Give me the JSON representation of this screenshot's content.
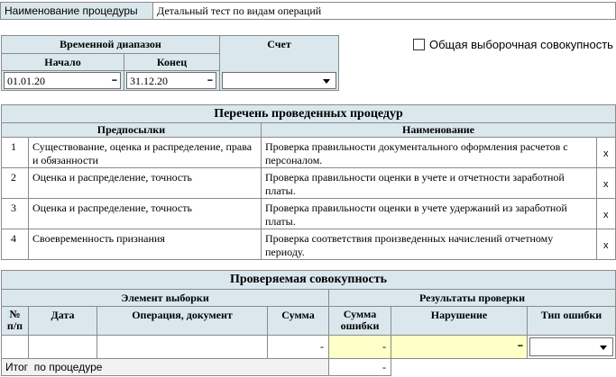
{
  "procedure": {
    "label": "Наименование процедуры",
    "value": "Детальный тест по видам операций"
  },
  "time_range": {
    "header": "Временной диапазон",
    "start_label": "Начало",
    "end_label": "Конец",
    "start_value": "01.01.20",
    "end_value": "31.12.20"
  },
  "account": {
    "header": "Счет",
    "value": ""
  },
  "total_population": {
    "label": "Общая выборочная совокупность",
    "checked": false
  },
  "procedures_list": {
    "title": "Перечень проведенных процедур",
    "col_premises": "Предпосылки",
    "col_name": "Наименование",
    "rows": [
      {
        "num": "1",
        "premise": "Существование, оценка и распределение, права и обязанности",
        "name": "Проверка правильности документального оформления расчетов с персоналом.",
        "dots": "...",
        "x": "x"
      },
      {
        "num": "2",
        "premise": "Оценка и распределение, точность",
        "name": "Проверка правильности оценки в учете и отчетности заработной платы.",
        "dots": "...",
        "x": "x"
      },
      {
        "num": "3",
        "premise": "Оценка и распределение, точность",
        "name": "Проверка правильности оценки в учете удержаний из заработной платы.",
        "dots": "...",
        "x": "x"
      },
      {
        "num": "4",
        "premise": "Своевременность признания",
        "name": "Проверка соответствия произведенных начислений отчетному периоду.",
        "dots": "...",
        "x": "x"
      }
    ]
  },
  "population": {
    "title": "Проверяемая совокупность",
    "sample_element": "Элемент выборки",
    "check_results": "Результаты проверки",
    "col_num": "№ п/п",
    "col_date": "Дата",
    "col_operation": "Операция, документ",
    "col_sum": "Сумма",
    "col_error_sum": "Сумма ошибки",
    "col_violation": "Нарушение",
    "col_error_type": "Тип ошибки",
    "row": {
      "num": "",
      "date": "",
      "operation": "",
      "sum": "-",
      "error_sum": "-",
      "violation": "",
      "dots": "...",
      "error_type": ""
    },
    "total_label": "Итог  по процедуре",
    "total_value": "-"
  }
}
